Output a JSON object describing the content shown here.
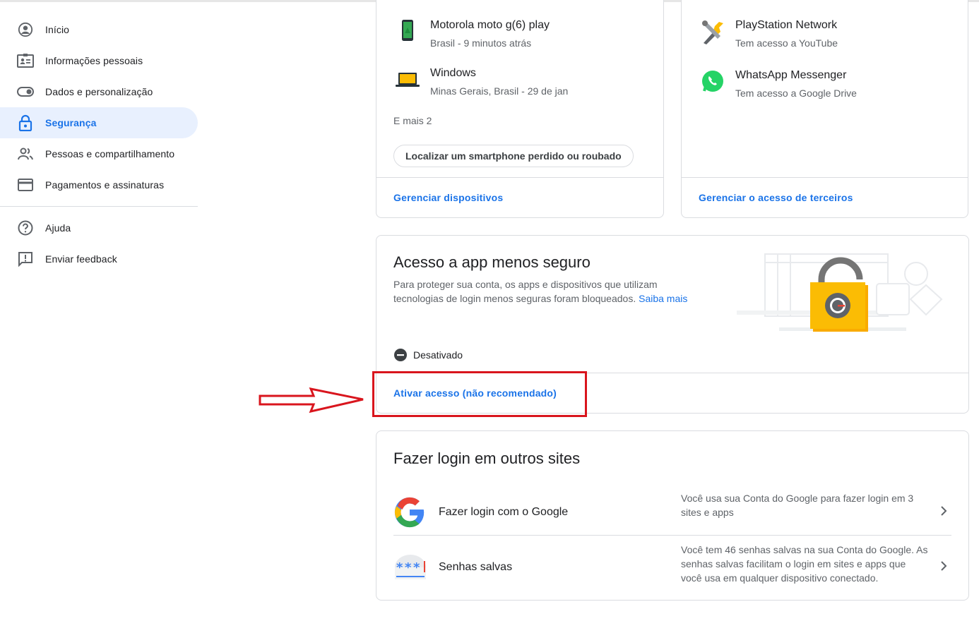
{
  "sidebar": {
    "items": [
      {
        "label": "Início"
      },
      {
        "label": "Informações pessoais"
      },
      {
        "label": "Dados e personalização"
      },
      {
        "label": "Segurança"
      },
      {
        "label": "Pessoas e compartilhamento"
      },
      {
        "label": "Pagamentos e assinaturas"
      }
    ],
    "secondary": [
      {
        "label": "Ajuda"
      },
      {
        "label": "Enviar feedback"
      }
    ]
  },
  "devices": {
    "items": [
      {
        "name": "Motorola moto g(6) play",
        "detail": "Brasil - 9 minutos atrás"
      },
      {
        "name": "Windows",
        "detail": "Minas Gerais, Brasil - 29 de jan"
      }
    ],
    "more": "E mais 2",
    "find_phone": "Localizar um smartphone perdido ou roubado",
    "manage": "Gerenciar dispositivos"
  },
  "third_party": {
    "items": [
      {
        "name": "PlayStation Network",
        "detail": "Tem acesso a YouTube"
      },
      {
        "name": "WhatsApp Messenger",
        "detail": "Tem acesso a Google Drive"
      }
    ],
    "manage": "Gerenciar o acesso de terceiros"
  },
  "less_secure": {
    "title": "Acesso a app menos seguro",
    "desc_line1": "Para proteger sua conta, os apps e dispositivos que utilizam",
    "desc_line2": "tecnologias de login menos seguras foram bloqueados.",
    "learn_more": "Saiba mais",
    "status": "Desativado",
    "enable": "Ativar acesso (não recomendado)"
  },
  "other_sites": {
    "title": "Fazer login em outros sites",
    "rows": [
      {
        "label": "Fazer login com o Google",
        "desc": "Você usa sua Conta do Google para fazer login em 3 sites e apps"
      },
      {
        "label": "Senhas salvas",
        "desc": "Você tem 46 senhas salvas na sua Conta do Google. As senhas salvas facilitam o login em sites e apps que você usa em qualquer dispositivo conectado."
      }
    ]
  },
  "colors": {
    "accent": "#1a73e8",
    "active_bg": "#e8f0fe",
    "annotation_red": "#d9151d"
  }
}
